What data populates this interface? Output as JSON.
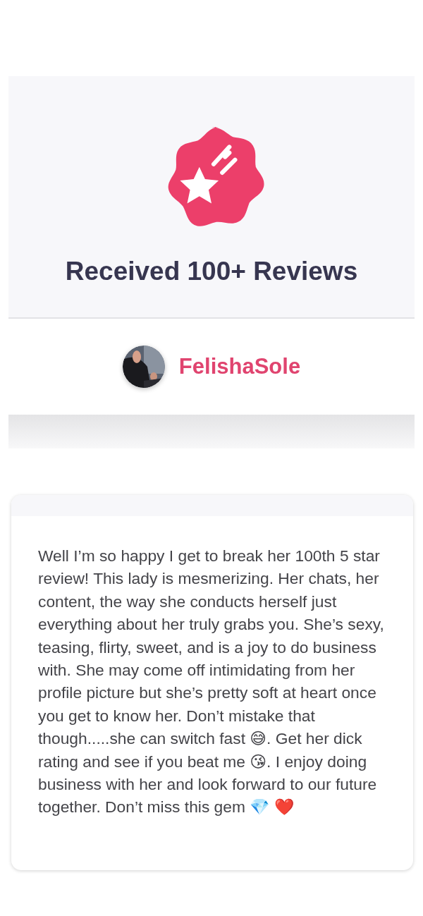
{
  "badge": {
    "title": "Received 100+ Reviews"
  },
  "reviewer": {
    "name": "FelishaSole"
  },
  "review": {
    "text": "Well I’m so happy I get to break her 100th 5 star review! This lady is mesmerizing. Her chats, her content, the way she conducts herself just everything about her truly grabs you. She’s sexy, teasing, flirty, sweet, and is a joy to do business with. She may come off intimidating from her profile picture but she’s pretty soft at heart once you get to know her. Don’t mistake that though.....she can switch fast 😅. Get her dick rating and see if you beat me 😘. I enjoy doing business with her and look forward to our future together. Don’t miss this gem 💎 ❤️"
  }
}
